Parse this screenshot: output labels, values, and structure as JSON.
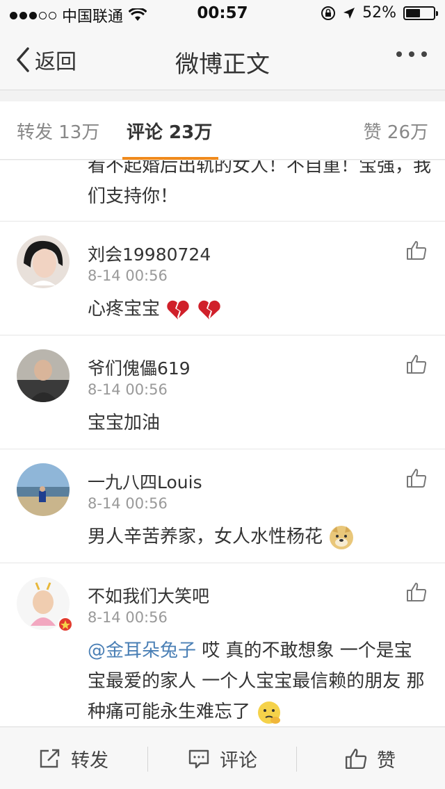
{
  "status_bar": {
    "carrier": "中国联通",
    "time": "00:57",
    "battery": "52%",
    "battery_level": 0.52
  },
  "nav": {
    "back_label": "返回",
    "title": "微博正文"
  },
  "tabs": {
    "repost": "转发 13万",
    "comment": "评论 23万",
    "like": "赞 26万"
  },
  "partial_comment": {
    "text": "看不起婚后出轨的女人！不自重！宝强，我们支持你！"
  },
  "comments": [
    {
      "username": "刘会19980724",
      "time": "8-14 00:56",
      "text": "心疼宝宝"
    },
    {
      "username": "爷们傀儡619",
      "time": "8-14 00:56",
      "text": "宝宝加油"
    },
    {
      "username": "一九八四Louis",
      "time": "8-14 00:56",
      "text": "男人辛苦养家，女人水性杨花"
    },
    {
      "username": "不如我们大笑吧",
      "time": "8-14 00:56",
      "mention": "@金耳朵兔子",
      "text": " 哎 真的不敢想象 一个是宝宝最爱的家人 一个人宝宝最信赖的朋友 那种痛可能永生难忘了"
    }
  ],
  "toolbar": {
    "repost": "转发",
    "comment": "评论",
    "like": "赞"
  },
  "icons": {
    "back": "chevron-left-icon",
    "more": "more-icon",
    "like": "thumbs-up-icon",
    "repost": "share-icon",
    "comment": "comment-icon",
    "location": "location-arrow-icon",
    "wifi": "wifi-icon",
    "lock": "rotation-lock-icon"
  },
  "colors": {
    "accent": "#f08a1c",
    "mention": "#4a7fb5"
  }
}
